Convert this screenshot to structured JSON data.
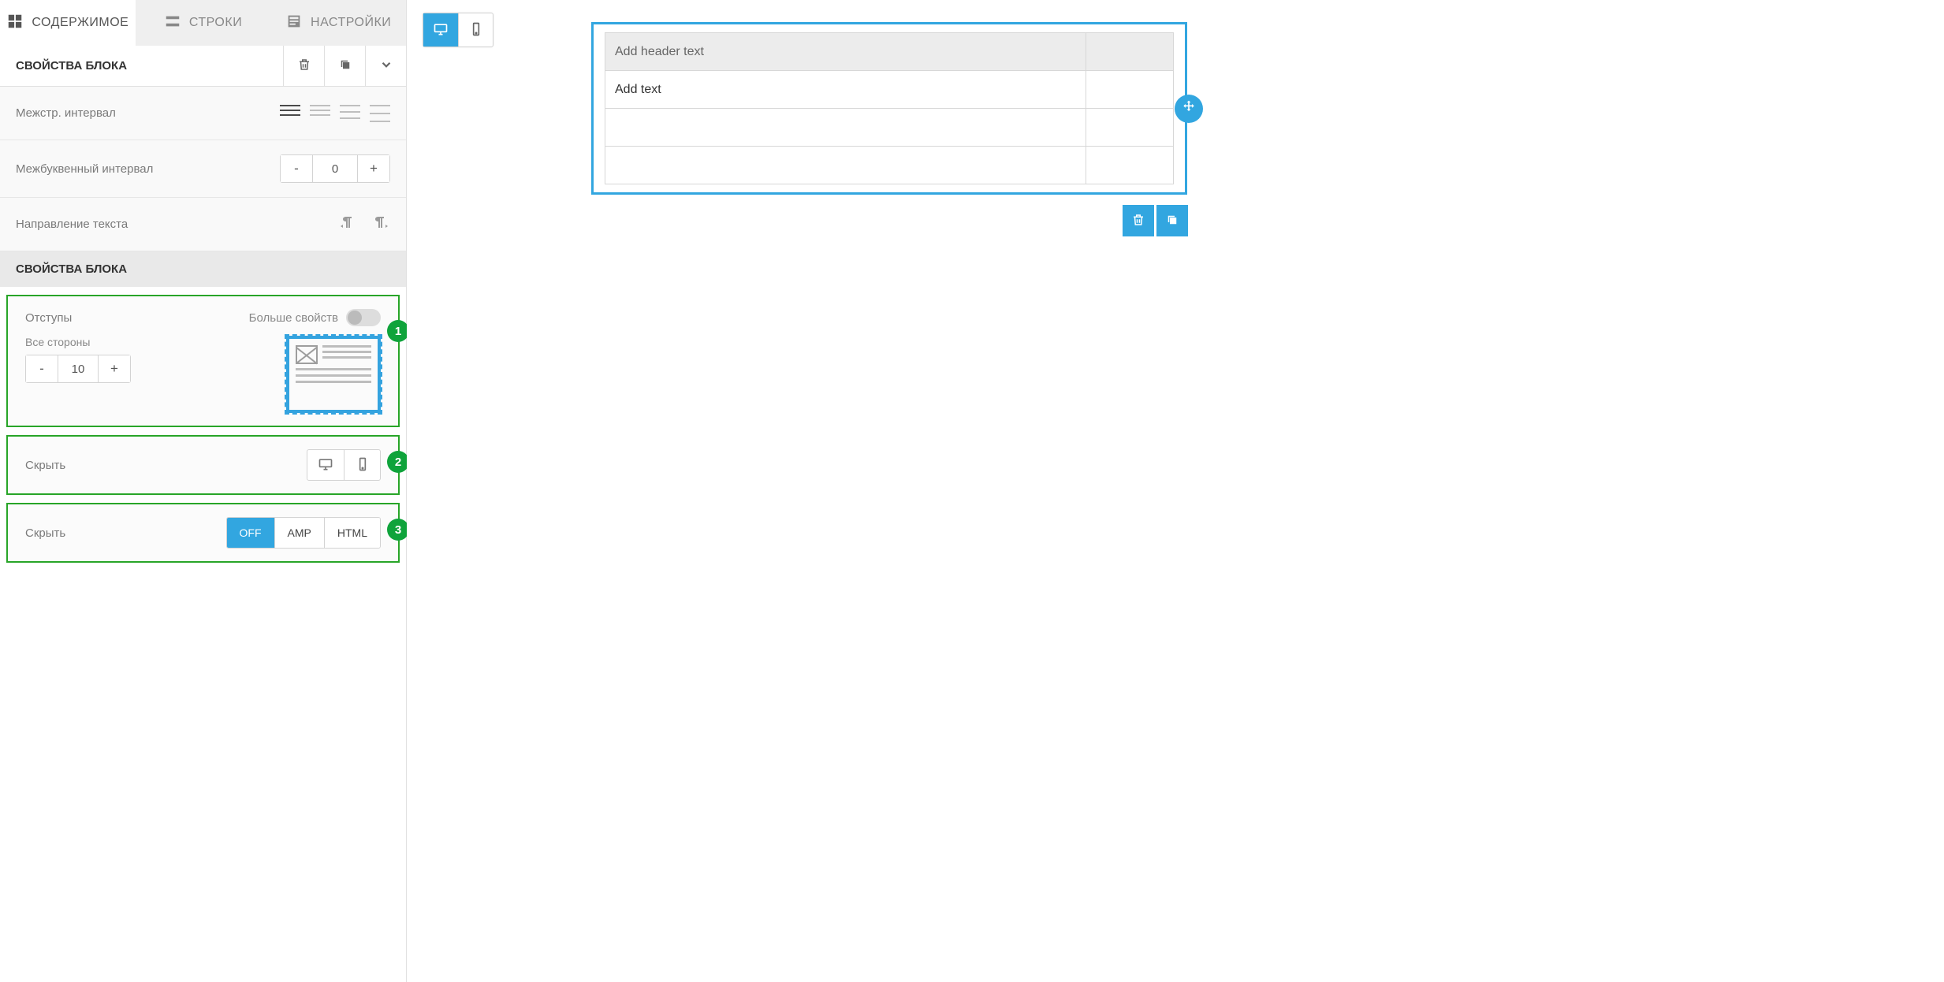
{
  "tabs": {
    "content": "СОДЕРЖИМОЕ",
    "rows": "СТРОКИ",
    "settings": "НАСТРОЙКИ"
  },
  "header": {
    "title": "СВОЙСТВА БЛОКА"
  },
  "props": {
    "line_spacing": "Межстр. интервал",
    "letter_spacing": {
      "label": "Межбуквенный интервал",
      "value": "0"
    },
    "text_direction": "Направление текста"
  },
  "subheader": "СВОЙСТВА БЛОКА",
  "padding_box": {
    "badge": "1",
    "label": "Отступы",
    "more_props": "Больше свойств",
    "all_sides": "Все стороны",
    "value": "10"
  },
  "hide_device_box": {
    "badge": "2",
    "label": "Скрыть"
  },
  "hide_format_box": {
    "badge": "3",
    "label": "Скрыть",
    "options": [
      "OFF",
      "AMP",
      "HTML"
    ],
    "active": "OFF"
  },
  "preview": {
    "table": {
      "header_placeholder": "Add header text",
      "cell_placeholder": "Add text"
    }
  },
  "colors": {
    "accent": "#32a6e0",
    "highlight_green": "#28a528"
  }
}
